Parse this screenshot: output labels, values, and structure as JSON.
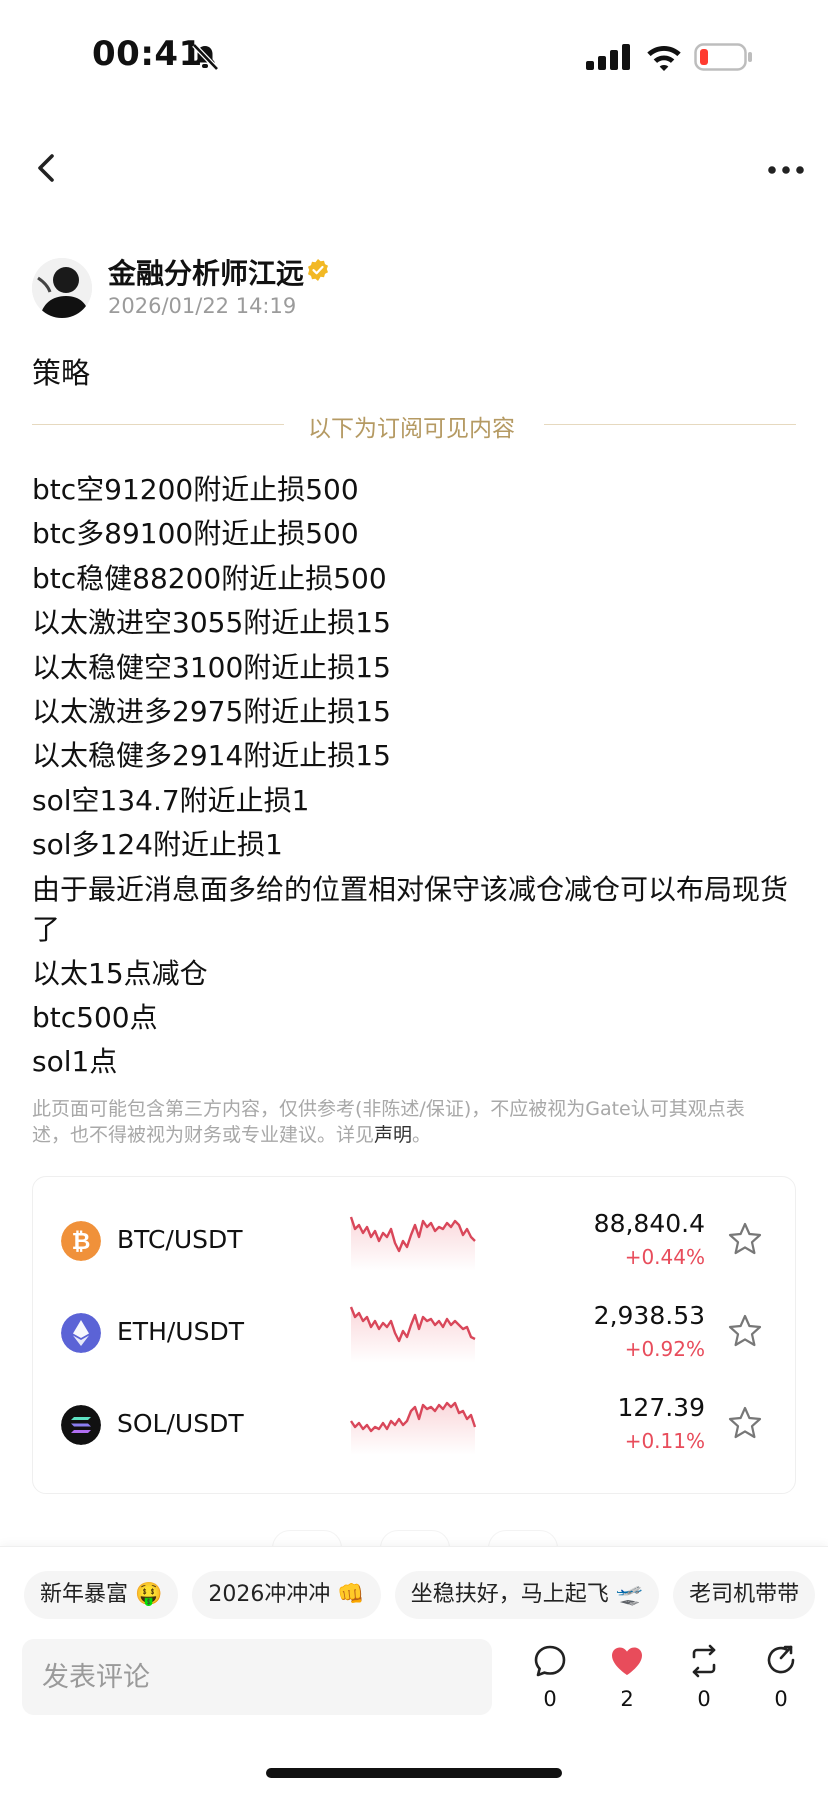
{
  "status_bar": {
    "time": "00:41"
  },
  "author": {
    "name": "金融分析师江远",
    "date": "2026/01/22 14:19"
  },
  "post": {
    "title": "策略",
    "divider_text": "以下为订阅可见内容",
    "lines": [
      "btc空91200附近止损500",
      "btc多89100附近止损500",
      "btc稳健88200附近止损500",
      "以太激进空3055附近止损15",
      "以太稳健空3100附近止损15",
      "以太激进多2975附近止损15",
      "以太稳健多2914附近止损15",
      "sol空134.7附近止损1",
      "sol多124附近止损1",
      "由于最近消息面多给的位置相对保守该减仓减仓可以布局现货了",
      "以太15点减仓",
      "btc500点",
      "sol1点"
    ],
    "disclaimer": "此页面可能包含第三方内容，仅供参考(非陈述/保证)，不应被视为Gate认可其观点表述，也不得被视为财务或专业建议。详见",
    "disclaimer_link": "声明",
    "disclaimer_end": "。"
  },
  "markets": [
    {
      "pair": "BTC/USDT",
      "price": "88,840.4",
      "change": "+0.44%",
      "icon": "bitcoin-icon",
      "color": "#f0913a"
    },
    {
      "pair": "ETH/USDT",
      "price": "2,938.53",
      "change": "+0.92%",
      "icon": "ethereum-icon",
      "color": "#5b63d6"
    },
    {
      "pair": "SOL/USDT",
      "price": "127.39",
      "change": "+0.11%",
      "icon": "solana-icon",
      "color": "#111111"
    }
  ],
  "chips": [
    "新年暴富 🤑",
    "2026冲冲冲 👊",
    "坐稳扶好，马上起飞 🛫",
    "老司机带带"
  ],
  "comment": {
    "placeholder": "发表评论"
  },
  "actions": {
    "comments": "0",
    "likes": "2",
    "reposts": "0",
    "shares": "0"
  },
  "colors": {
    "accent_gold": "#b59a63",
    "down_red": "#e84c5b"
  }
}
